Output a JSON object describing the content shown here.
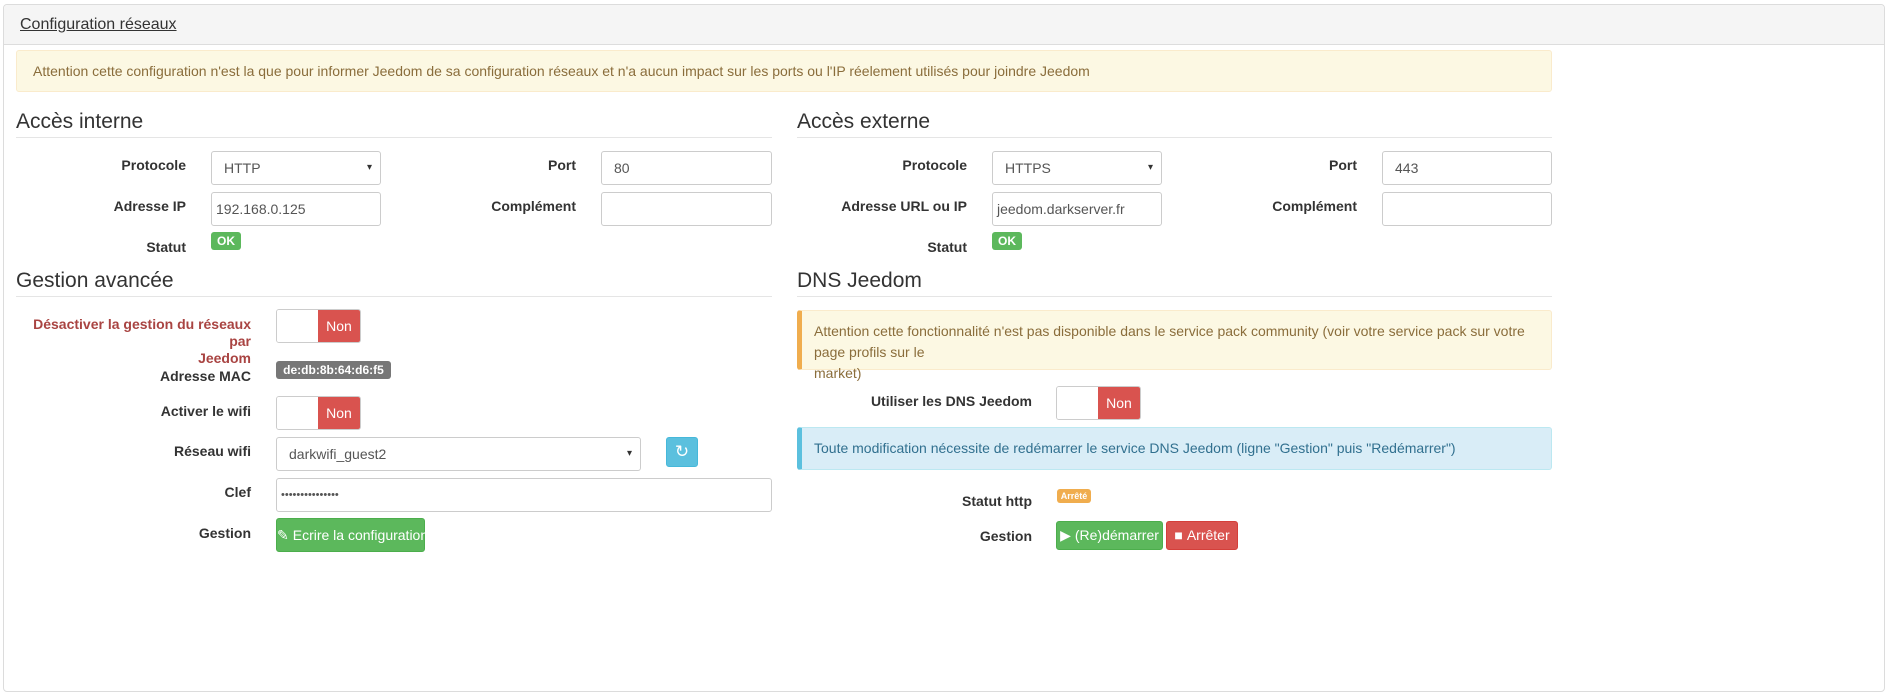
{
  "panel": {
    "title": "Configuration réseaux"
  },
  "notice": "Attention cette configuration n'est la que pour informer Jeedom de sa configuration réseaux et n'a aucun impact sur les ports ou l'IP réelement utilisés pour joindre Jeedom",
  "internal": {
    "title": "Accès interne",
    "protocol_label": "Protocole",
    "protocol_value": "HTTP",
    "port_label": "Port",
    "port_value": "80",
    "ip_label": "Adresse IP",
    "ip_value": "192.168.0.125",
    "complement_label": "Complément",
    "complement_value": "",
    "status_label": "Statut",
    "status_value": "OK"
  },
  "external": {
    "title": "Accès externe",
    "protocol_label": "Protocole",
    "protocol_value": "HTTPS",
    "port_label": "Port",
    "port_value": "443",
    "url_label": "Adresse URL ou IP",
    "url_value": "jeedom.darkserver.fr",
    "complement_label": "Complément",
    "complement_value": "",
    "status_label": "Statut",
    "status_value": "OK"
  },
  "advanced": {
    "title": "Gestion avancée",
    "disable_label_line1": "Désactiver la gestion du réseaux par",
    "disable_label_line2": "Jeedom",
    "disable_state": "Non",
    "mac_label": "Adresse MAC",
    "mac_value": "de:db:8b:64:d6:f5",
    "wifi_label": "Activer le wifi",
    "wifi_state": "Non",
    "network_label": "Réseau wifi",
    "network_value": "darkwifi_guest2",
    "key_label": "Clef",
    "key_value": "•••••••••••••••",
    "manage_label": "Gestion",
    "write_button": "Ecrire la configuration"
  },
  "dns": {
    "title": "DNS Jeedom",
    "warning_line1": "Attention cette fonctionnalité n'est pas disponible dans le service pack community (voir votre service pack sur votre page profils sur le",
    "warning_line2": "market)",
    "use_label": "Utiliser les DNS Jeedom",
    "use_state": "Non",
    "info": "Toute modification nécessite de redémarrer le service DNS Jeedom (ligne \"Gestion\" puis \"Redémarrer\")",
    "http_status_label": "Statut http",
    "http_status_value": "Arrêté",
    "manage_label": "Gestion",
    "restart_button": "(Re)démarrer",
    "stop_button": "Arrêter"
  },
  "icons": {
    "caret": "▾",
    "refresh": "↻",
    "pencil": "✎",
    "play": "▶",
    "stop": "■"
  },
  "colors": {
    "success": "#5cb85c",
    "danger": "#d9534f",
    "info": "#5bc0de",
    "warning": "#f0ad4e"
  }
}
